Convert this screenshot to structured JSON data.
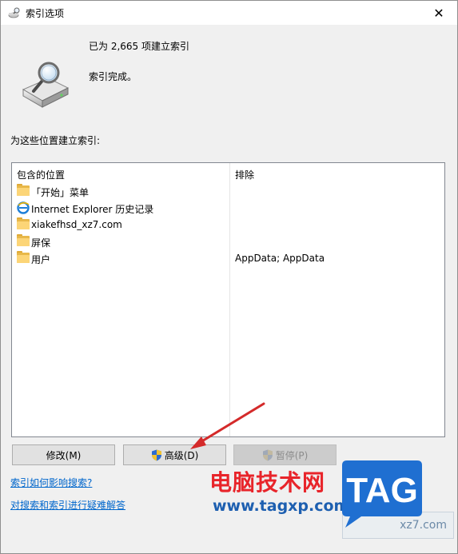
{
  "window": {
    "title": "索引选项",
    "close_glyph": "✕"
  },
  "summary": {
    "indexed_count_text": "已为 2,665 项建立索引",
    "status_text": "索引完成。"
  },
  "locations": {
    "section_label": "为这些位置建立索引:",
    "columns": [
      "包含的位置",
      "排除"
    ],
    "rows": [
      {
        "icon": "folder-icon",
        "location": "「开始」菜单",
        "exclude": ""
      },
      {
        "icon": "internet-explorer-icon",
        "location": "Internet Explorer 历史记录",
        "exclude": ""
      },
      {
        "icon": "folder-icon",
        "location": "xiakefhsd_xz7.com",
        "exclude": ""
      },
      {
        "icon": "folder-icon",
        "location": "屏保",
        "exclude": ""
      },
      {
        "icon": "folder-icon",
        "location": "用户",
        "exclude": "AppData; AppData"
      }
    ]
  },
  "buttons": {
    "modify": "修改(M)",
    "advanced": "高级(D)",
    "pause": "暂停(P)"
  },
  "links": {
    "how_indexing_affects": "索引如何影响搜索?",
    "troubleshoot": "对搜索和索引进行疑难解答"
  },
  "watermark": {
    "site_name": "电脑技术网",
    "site_url": "www.tagxp.com",
    "tag_logo": "TAG",
    "ghost_text": "xz7.com"
  },
  "colors": {
    "link": "#0066cc",
    "arrow": "#d42a2a",
    "watermark_red": "#e8242a",
    "watermark_blue": "#1d5fb0"
  }
}
